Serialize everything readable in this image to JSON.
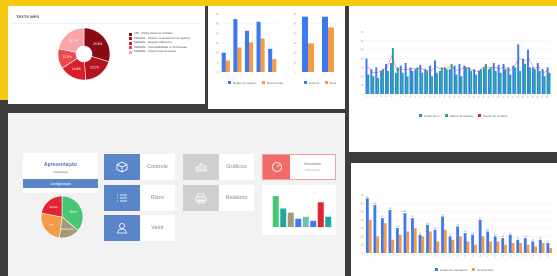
{
  "panel1": {
    "title": "TEXTS WFS",
    "pie_legend": [
      {
        "label": "APP - Pólicia oficial nos unidades",
        "color": "#8b0b15"
      },
      {
        "label": "FEDERAL - Pólicia e contendimento do registros",
        "color": "#b3141f"
      },
      {
        "label": "FEDERAL - Registro instituciona",
        "color": "#d81e2a"
      },
      {
        "label": "FEDERAL - Incompatibilidade no Sit.Pessoais",
        "color": "#f04a4e"
      },
      {
        "label": "FEDERAL - Pólicia Crivia de cabeça",
        "color": "#f9a4a6"
      }
    ],
    "pie_labels": [
      "29.8%",
      "19.2%",
      "16.8%",
      "12.5%",
      "21.7%"
    ]
  },
  "panel2": {
    "legend_a": [
      "Dados do registro",
      "Ocorrências"
    ],
    "legend_b": [
      "Anterior",
      "Atual"
    ]
  },
  "panel3": {
    "legend": [
      "Dados de tr",
      "Dados de resíduo",
      "Dados de cuidado"
    ]
  },
  "panel4": {
    "apresentacao": {
      "title": "Apresentação",
      "subtitle": "Instituições"
    },
    "config_button": "Configuração",
    "pie_labels": [
      "Baixo",
      "Moderado",
      "Alto",
      "Crítico"
    ],
    "tiles": [
      {
        "label": "Controle",
        "icon": "cube-icon"
      },
      {
        "label": "Risco",
        "icon": "list-icon"
      },
      {
        "label": "Valor",
        "icon": "user-icon"
      },
      {
        "label": "Gráficos",
        "icon": "bar-chart-icon"
      },
      {
        "label": "Relatório",
        "icon": "printer-icon"
      }
    ],
    "gauge_tile": {
      "title": "Velocidade",
      "subtitle": "Indicadores"
    }
  },
  "panel5": {
    "legend": [
      "Dados de referência",
      "Ocorrências"
    ]
  },
  "colors": {
    "accent_yellow": "#f6c90e",
    "blue": "#3d79f0",
    "orange": "#f59a45",
    "teal": "#1fa99a",
    "green": "#47c774",
    "red": "#e02430"
  },
  "chart_data": [
    {
      "type": "pie",
      "categories": [
        "A",
        "B",
        "C",
        "D",
        "E"
      ],
      "values": [
        29.8,
        19.2,
        16.8,
        12.5,
        21.7
      ]
    },
    {
      "type": "bar",
      "categories": [
        "1",
        "2",
        "3",
        "4",
        "5"
      ],
      "series": [
        {
          "name": "Dados do registro",
          "values": [
            15,
            41,
            32,
            39,
            18
          ]
        },
        {
          "name": "Ocorrências",
          "values": [
            9,
            19,
            23,
            26,
            10
          ]
        }
      ],
      "ylim": [
        0,
        45
      ]
    },
    {
      "type": "bar",
      "categories": [
        "1",
        "2"
      ],
      "series": [
        {
          "name": "Anterior",
          "values": [
            62,
            62
          ]
        },
        {
          "name": "Atual",
          "values": [
            32,
            50
          ]
        }
      ],
      "ylim": [
        0,
        65
      ]
    },
    {
      "type": "bar",
      "categories": [
        "1",
        "2",
        "3",
        "4",
        "5",
        "6",
        "7",
        "8",
        "9",
        "10",
        "11",
        "12",
        "13",
        "14",
        "15",
        "16",
        "17",
        "18",
        "19",
        "20",
        "21",
        "22",
        "23",
        "24",
        "25",
        "26",
        "27",
        "28",
        "29",
        "30",
        "31",
        "32",
        "33",
        "34",
        "35",
        "36",
        "37",
        "38"
      ],
      "series": [
        {
          "name": "Dados de tr",
          "values": [
            40,
            28,
            30,
            26,
            34,
            35,
            24,
            32,
            35,
            30,
            28,
            33,
            28,
            32,
            38,
            26,
            30,
            28,
            32,
            34,
            32,
            30,
            28,
            26,
            30,
            28,
            35,
            33,
            34,
            30,
            32,
            56,
            40,
            50,
            30,
            35,
            28,
            30
          ]
        },
        {
          "name": "Dados de resíduo",
          "values": [
            22,
            20,
            18,
            28,
            26,
            52,
            30,
            24,
            20,
            26,
            30,
            24,
            26,
            20,
            24,
            30,
            28,
            34,
            22,
            20,
            30,
            26,
            22,
            28,
            34,
            30,
            26,
            24,
            28,
            22,
            30,
            26,
            34,
            30,
            28,
            26,
            20,
            24
          ]
        }
      ],
      "ylim": [
        0,
        70
      ]
    },
    {
      "type": "bar",
      "categories": [
        "Baixo",
        "Moderado",
        "Alto",
        "Crítico",
        "5",
        "6",
        "7",
        "8"
      ],
      "series": [
        {
          "name": "",
          "values": [
            30,
            18,
            14,
            8,
            10,
            6,
            24,
            10
          ]
        }
      ],
      "ylim": [
        0,
        35
      ]
    },
    {
      "type": "pie",
      "categories": [
        "Baixo",
        "Moderado",
        "Alto",
        "Crítico"
      ],
      "values": [
        36,
        16,
        26,
        22
      ]
    },
    {
      "type": "bar",
      "categories": [
        "1",
        "2",
        "3",
        "4",
        "5",
        "6",
        "7",
        "8",
        "9",
        "10",
        "11",
        "12",
        "13",
        "14",
        "15",
        "16",
        "17",
        "18",
        "19",
        "20",
        "21",
        "22",
        "23",
        "24",
        "25"
      ],
      "series": [
        {
          "name": "Dados de referência",
          "values": [
            66,
            58,
            42,
            52,
            30,
            48,
            42,
            22,
            34,
            28,
            44,
            20,
            32,
            24,
            22,
            40,
            26,
            20,
            18,
            22,
            16,
            18,
            14,
            16,
            12
          ]
        },
        {
          "name": "Ocorrências",
          "values": [
            40,
            20,
            36,
            16,
            22,
            26,
            30,
            20,
            26,
            14,
            28,
            16,
            20,
            14,
            10,
            20,
            14,
            14,
            10,
            12,
            12,
            10,
            8,
            12,
            6
          ]
        }
      ],
      "ylim": [
        0,
        70
      ]
    }
  ]
}
